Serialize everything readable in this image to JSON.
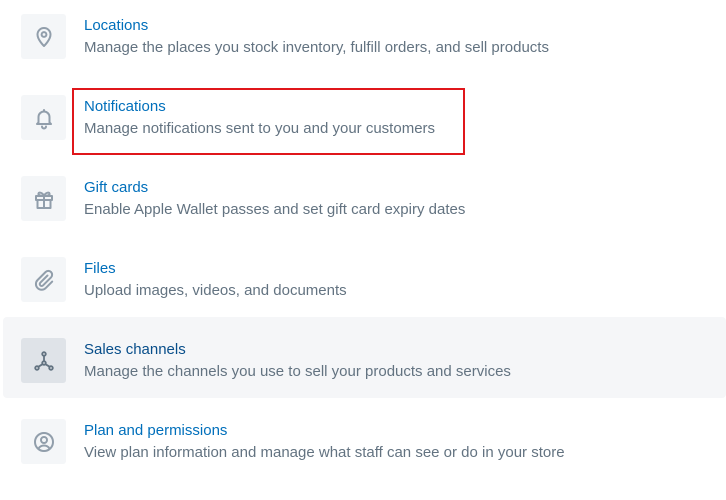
{
  "settings_items": [
    {
      "title": "Locations",
      "description": "Manage the places you stock inventory, fulfill orders, and sell products",
      "icon": "location-pin-icon"
    },
    {
      "title": "Notifications",
      "description": "Manage notifications sent to you and your customers",
      "icon": "bell-icon"
    },
    {
      "title": "Gift cards",
      "description": "Enable Apple Wallet passes and set gift card expiry dates",
      "icon": "gift-icon"
    },
    {
      "title": "Files",
      "description": "Upload images, videos, and documents",
      "icon": "paperclip-icon"
    },
    {
      "title": "Sales channels",
      "description": "Manage the channels you use to sell your products and services",
      "icon": "channels-icon"
    },
    {
      "title": "Plan and permissions",
      "description": "View plan information and manage what staff can see or do in your store",
      "icon": "user-circle-icon"
    }
  ],
  "colors": {
    "title": "#006fbb",
    "description": "#637381",
    "icon": "#919eab",
    "highlight": "#e0161b"
  }
}
